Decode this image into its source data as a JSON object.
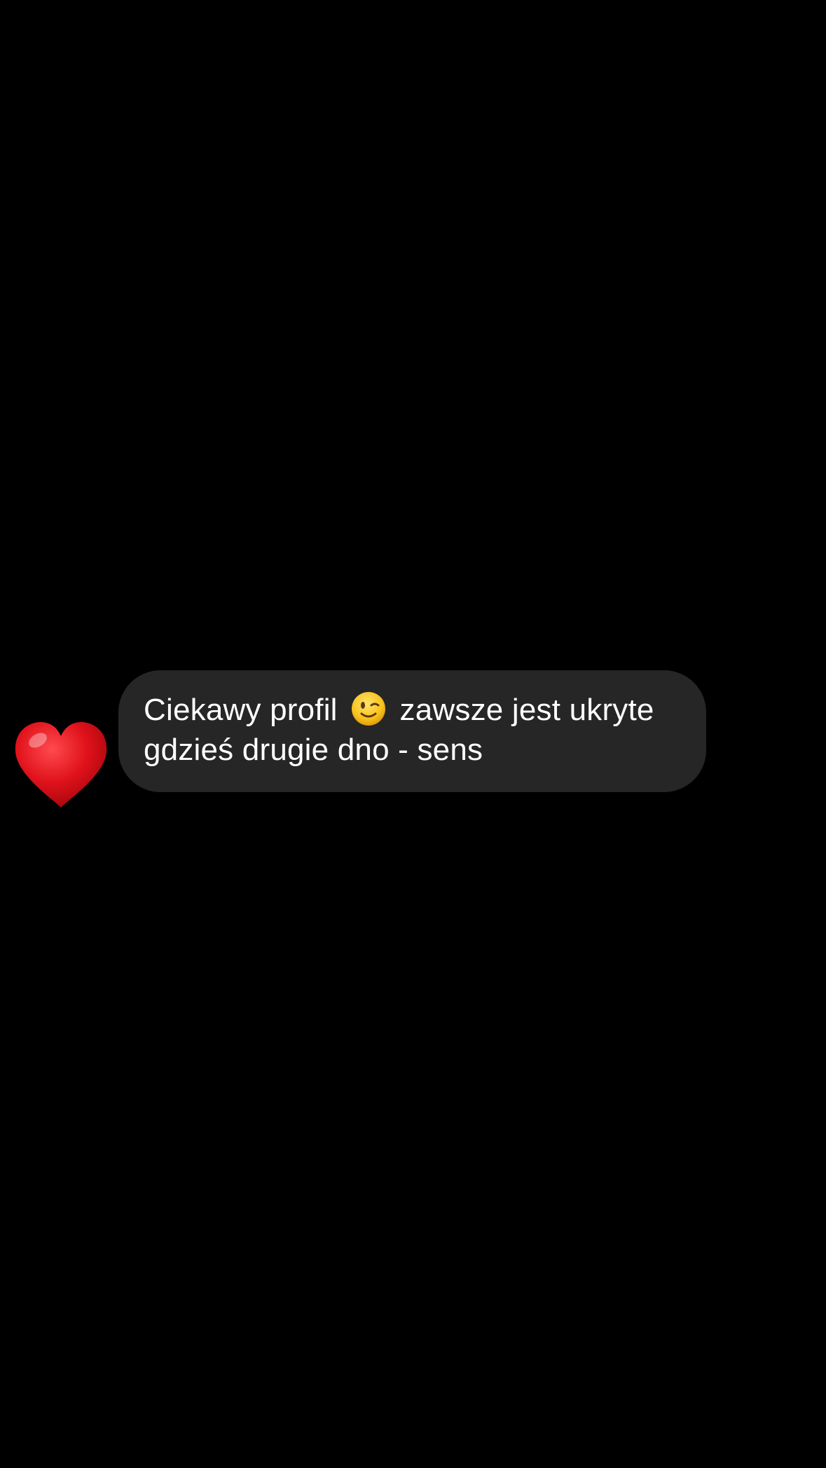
{
  "message": {
    "line1_before": "Ciekawy profil",
    "emoji": "wink-emoji",
    "line1_after": "zawsze jest ukryte",
    "line2": "gdzieś drugie dno - sens",
    "bubble_color": "#262626",
    "text_color": "#ffffff"
  },
  "reaction": {
    "icon": "red-heart-icon",
    "color": "#e4111a"
  },
  "background_color": "#000000"
}
